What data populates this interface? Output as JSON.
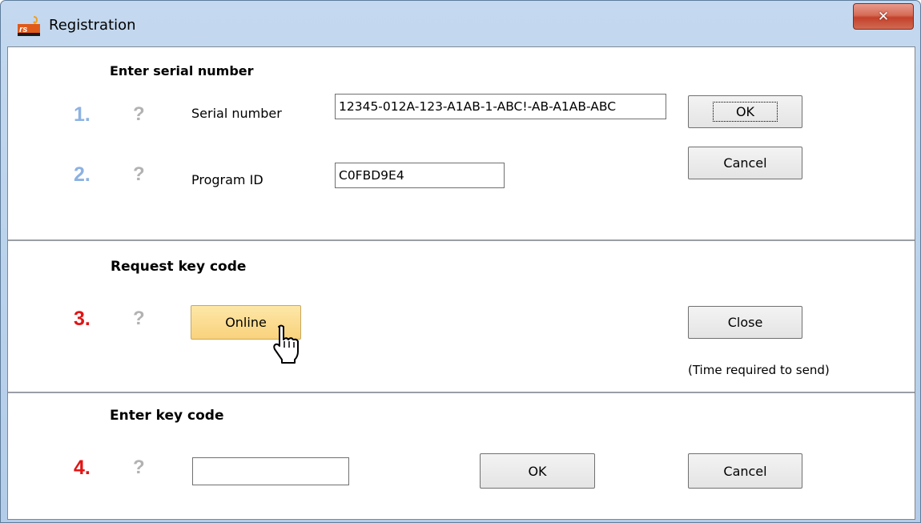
{
  "window": {
    "title": "Registration",
    "app_icon": "rs-app-icon",
    "close_glyph": "✕"
  },
  "sections": {
    "serial": {
      "heading": "Enter serial number",
      "step1": {
        "number": "1.",
        "help": "?",
        "label": "Serial number",
        "value": "12345-012A-123-A1AB-1-ABC!-AB-A1AB-ABC"
      },
      "step2": {
        "number": "2.",
        "help": "?",
        "label": "Program ID",
        "value": "C0FBD9E4"
      },
      "ok_label": "OK",
      "cancel_label": "Cancel"
    },
    "request": {
      "heading": "Request key code",
      "step3": {
        "number": "3.",
        "help": "?"
      },
      "online_label": "Online",
      "close_label": "Close",
      "note": "(Time required to send)"
    },
    "keycode": {
      "heading": "Enter key code",
      "step4": {
        "number": "4.",
        "help": "?",
        "value": "",
        "placeholder": ""
      },
      "ok_label": "OK",
      "cancel_label": "Cancel"
    }
  },
  "colors": {
    "step_active": "#e21414",
    "step_inactive": "#8db2e2",
    "hot_button": "#f9d27c",
    "titlebar": "#c4d9ef",
    "close_button": "#c4412a"
  },
  "icons": {
    "close": "close-icon",
    "cursor": "hand-pointer-icon"
  }
}
